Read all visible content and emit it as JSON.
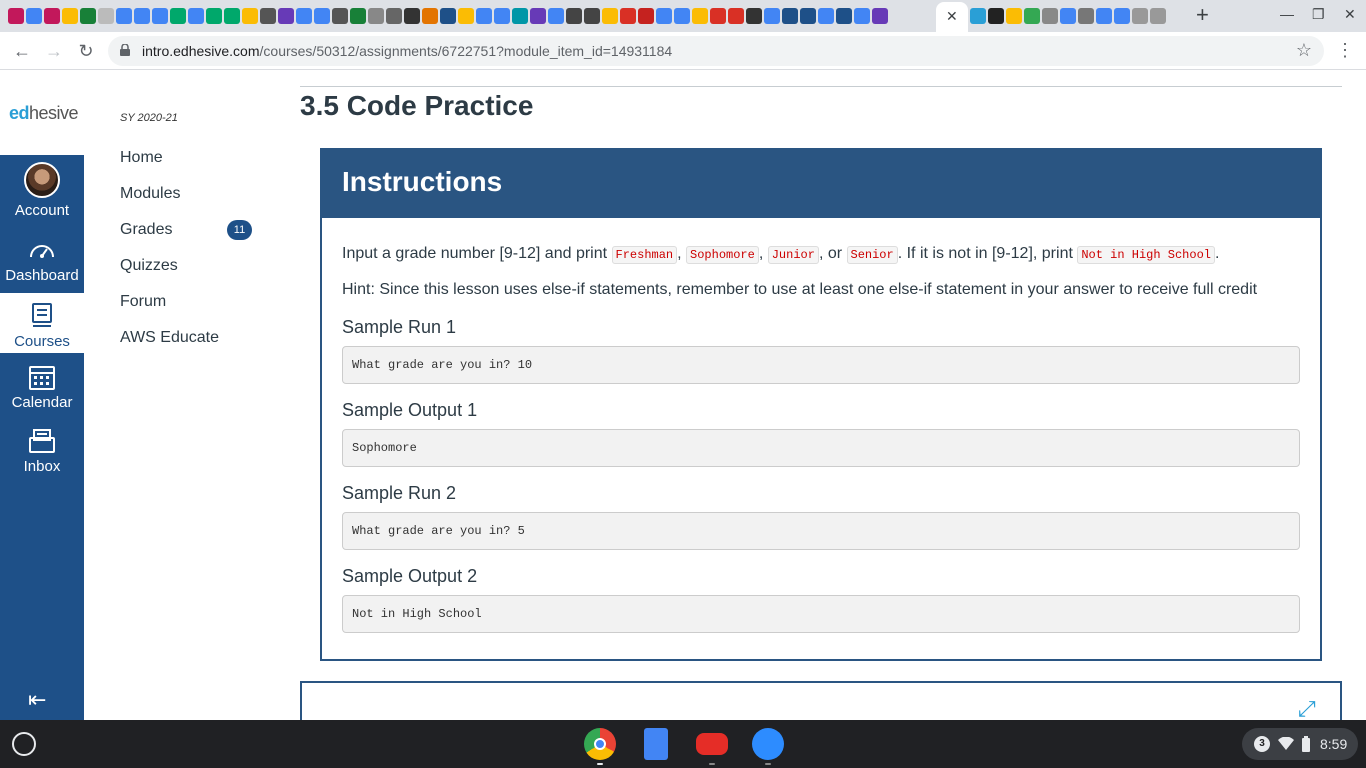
{
  "browser": {
    "active_tab_close": "✕",
    "new_tab": "+",
    "window_controls": {
      "minimize": "—",
      "restore": "❐",
      "close": "✕"
    },
    "url_host": "intro.edhesive.com",
    "url_path": "/courses/50312/assignments/6722751?module_item_id=14931184",
    "back_icon": "←",
    "forward_icon": "→",
    "reload_icon": "↻",
    "star_icon": "☆",
    "menu_icon": "⋮"
  },
  "global_nav": {
    "logo_ed": "ed",
    "logo_rest": "hesive",
    "items": [
      {
        "label": "Account",
        "icon": "avatar"
      },
      {
        "label": "Dashboard",
        "icon": "dashboard-icon"
      },
      {
        "label": "Courses",
        "icon": "courses-icon",
        "active": true
      },
      {
        "label": "Calendar",
        "icon": "calendar-icon"
      },
      {
        "label": "Inbox",
        "icon": "inbox-icon"
      }
    ],
    "collapse_icon": "⇤"
  },
  "course_nav": {
    "term": "SY 2020-21",
    "items": [
      {
        "label": "Home"
      },
      {
        "label": "Modules"
      },
      {
        "label": "Grades",
        "badge": "11"
      },
      {
        "label": "Quizzes"
      },
      {
        "label": "Forum"
      },
      {
        "label": "AWS Educate"
      }
    ]
  },
  "main": {
    "title": "3.5 Code Practice",
    "instructions": {
      "heading": "Instructions",
      "line1_a": "Input a grade number [9-12] and print ",
      "code_freshman": "Freshman",
      "sep1": ", ",
      "code_sophomore": "Sophomore",
      "sep2": ", ",
      "code_junior": "Junior",
      "sep3": ", or ",
      "code_senior": "Senior",
      "line1_b": ". If it is not in [9-12], print ",
      "code_not": "Not in High School",
      "line1_c": ".",
      "hint": "Hint: Since this lesson uses else-if statements, remember to use at least one else-if statement in your answer to receive full credit",
      "sections": [
        {
          "heading": "Sample Run 1",
          "code": "What grade are you in? 10"
        },
        {
          "heading": "Sample Output 1",
          "code": "Sophomore"
        },
        {
          "heading": "Sample Run 2",
          "code": "What grade are you in? 5"
        },
        {
          "heading": "Sample Output 2",
          "code": "Not in High School"
        }
      ]
    },
    "expand_icon": "⤢"
  },
  "shelf": {
    "notification_count": "3",
    "time": "8:59"
  },
  "colors": {
    "canvas_blue": "#1e5088",
    "instructions_blue": "#2a5582",
    "code_red": "#cc0000"
  }
}
